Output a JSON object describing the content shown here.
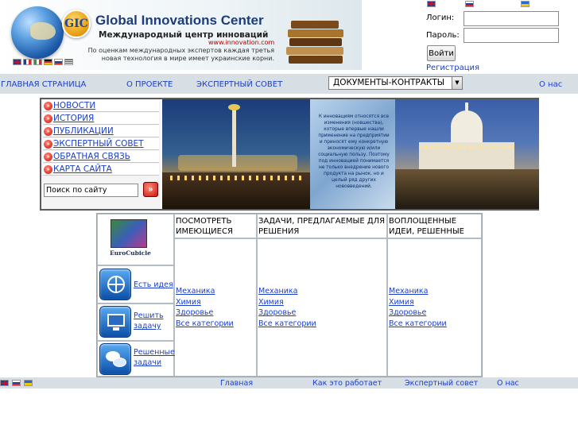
{
  "header": {
    "logo_badge": "GIC",
    "title": "Global Innovations Center",
    "subtitle": "Международный центр инноваций",
    "url": "www.innovation.com",
    "tagline": "По оценкам международных экспертов каждая третья новая технология в мире имеет украинские корни."
  },
  "login": {
    "login_label": "Логин:",
    "password_label": "Пароль:",
    "login_value": "",
    "password_value": "",
    "submit_label": "Войти",
    "register_label": "Регистрация"
  },
  "nav": {
    "home": "ГЛАВНАЯ СТРАНИЦА",
    "about_project": "О ПРОЕКТЕ",
    "expert_council": "ЭКСПЕРТНЫЙ СОВЕТ",
    "documents_select": "ДОКУМЕНТЫ-КОНТРАКТЫ",
    "about_us": "О нас"
  },
  "sidemenu": {
    "items": [
      {
        "label": "НОВОСТИ"
      },
      {
        "label": "ИСТОРИЯ"
      },
      {
        "label": "ПУБЛИКАЦИИ"
      },
      {
        "label": "ЭКСПЕРТНЫЙ СОВЕТ"
      },
      {
        "label": "ОБРАТНАЯ СВЯЗЬ"
      },
      {
        "label": "КАРТА САЙТА"
      }
    ],
    "search_value": "Поиск по сайту",
    "search_button": "»"
  },
  "banner_text": "К инновациям относятся все изменения (новшества), которые впервые нашли применение на предприятии и приносят ему конкретную экономическую и/или социальную пользу. Поэтому под инновацией понимается не только внедрение нового продукта на рынок, но и целый ряд других нововведений.",
  "grid": {
    "logo_text": "EuroCubicle",
    "columns": [
      {
        "title": "ПОСМОТРЕТЬ ИМЕЮЩИЕСЯ ИДЕИ",
        "links": [
          "Механика",
          "Химия",
          "Здоровье",
          "Все категории"
        ]
      },
      {
        "title": "ЗАДАЧИ, ПРЕДЛАГАЕМЫЕ ДЛЯ РЕШЕНИЯ",
        "links": [
          "Механика",
          "Химия",
          "Здоровье",
          "Все категории"
        ]
      },
      {
        "title": "ВОПЛОЩЕННЫЕ ИДЕИ, РЕШЕННЫЕ ЗАДАЧИ",
        "links": [
          "Механика",
          "Химия",
          "Здоровье",
          "Все категории"
        ]
      }
    ],
    "actions": [
      {
        "label": "Есть идея",
        "icon": "globe-icon"
      },
      {
        "label": "Решить задачу",
        "icon": "monitor-icon"
      },
      {
        "label": "Решенные задачи",
        "icon": "chat-bubbles-icon"
      }
    ]
  },
  "footer": {
    "home": "Главная",
    "how_it_works": "Как это работает",
    "expert_council": "Экспертный совет",
    "about_us": "О нас"
  },
  "colors": {
    "link": "#1a3ec9",
    "nav_bar": "#d8dfe4",
    "title": "#1d3c7a",
    "bullet": "#c9140a"
  }
}
